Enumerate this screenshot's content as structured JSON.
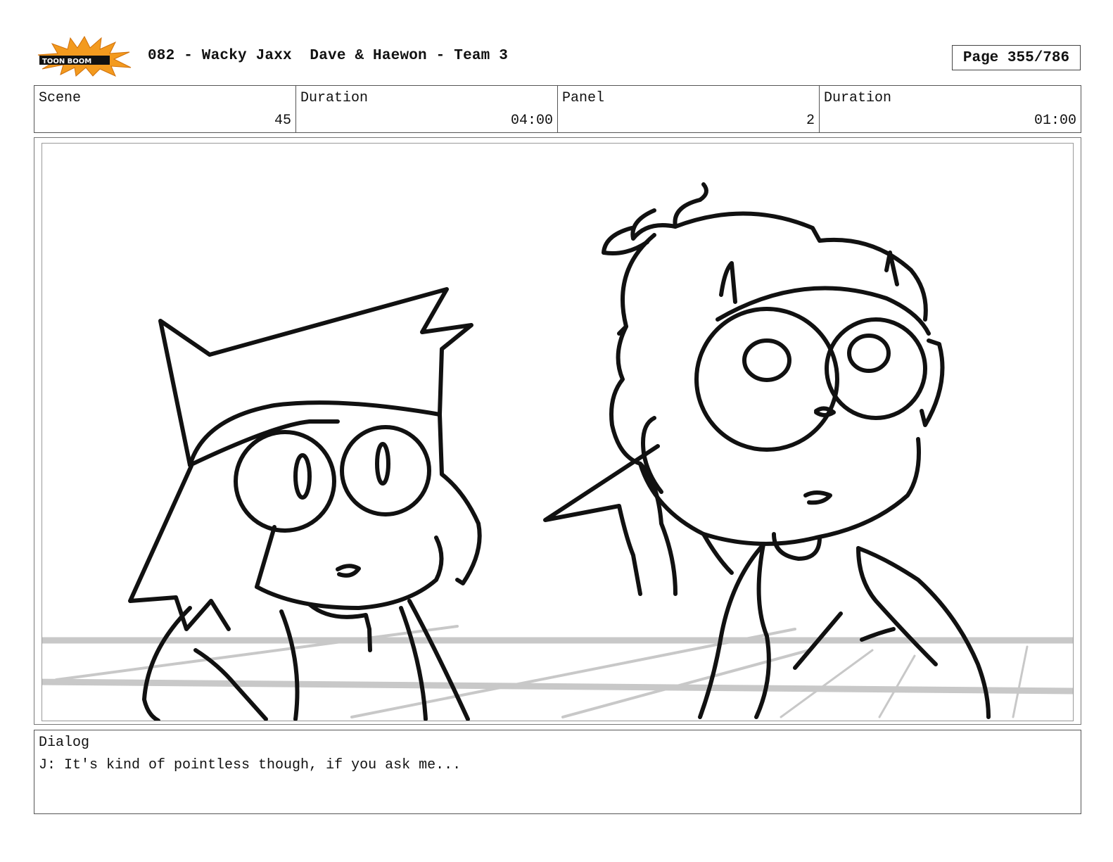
{
  "header": {
    "logo_text": "TOON BOOM",
    "title": "082 - Wacky Jaxx  Dave & Haewon - Team 3",
    "page": "Page 355/786"
  },
  "info": {
    "scene_label": "Scene",
    "scene_value": "45",
    "scene_duration_label": "Duration",
    "scene_duration_value": "04:00",
    "panel_label": "Panel",
    "panel_value": "2",
    "panel_duration_label": "Duration",
    "panel_duration_value": "01:00"
  },
  "dialog": {
    "label": "Dialog",
    "text": "J: It's kind of pointless though, if you ask me..."
  },
  "colors": {
    "logo_burst": "#f39a1e",
    "logo_text_bg": "#111111",
    "sketch_line": "#111111",
    "guide_line": "#c8c8c8"
  }
}
